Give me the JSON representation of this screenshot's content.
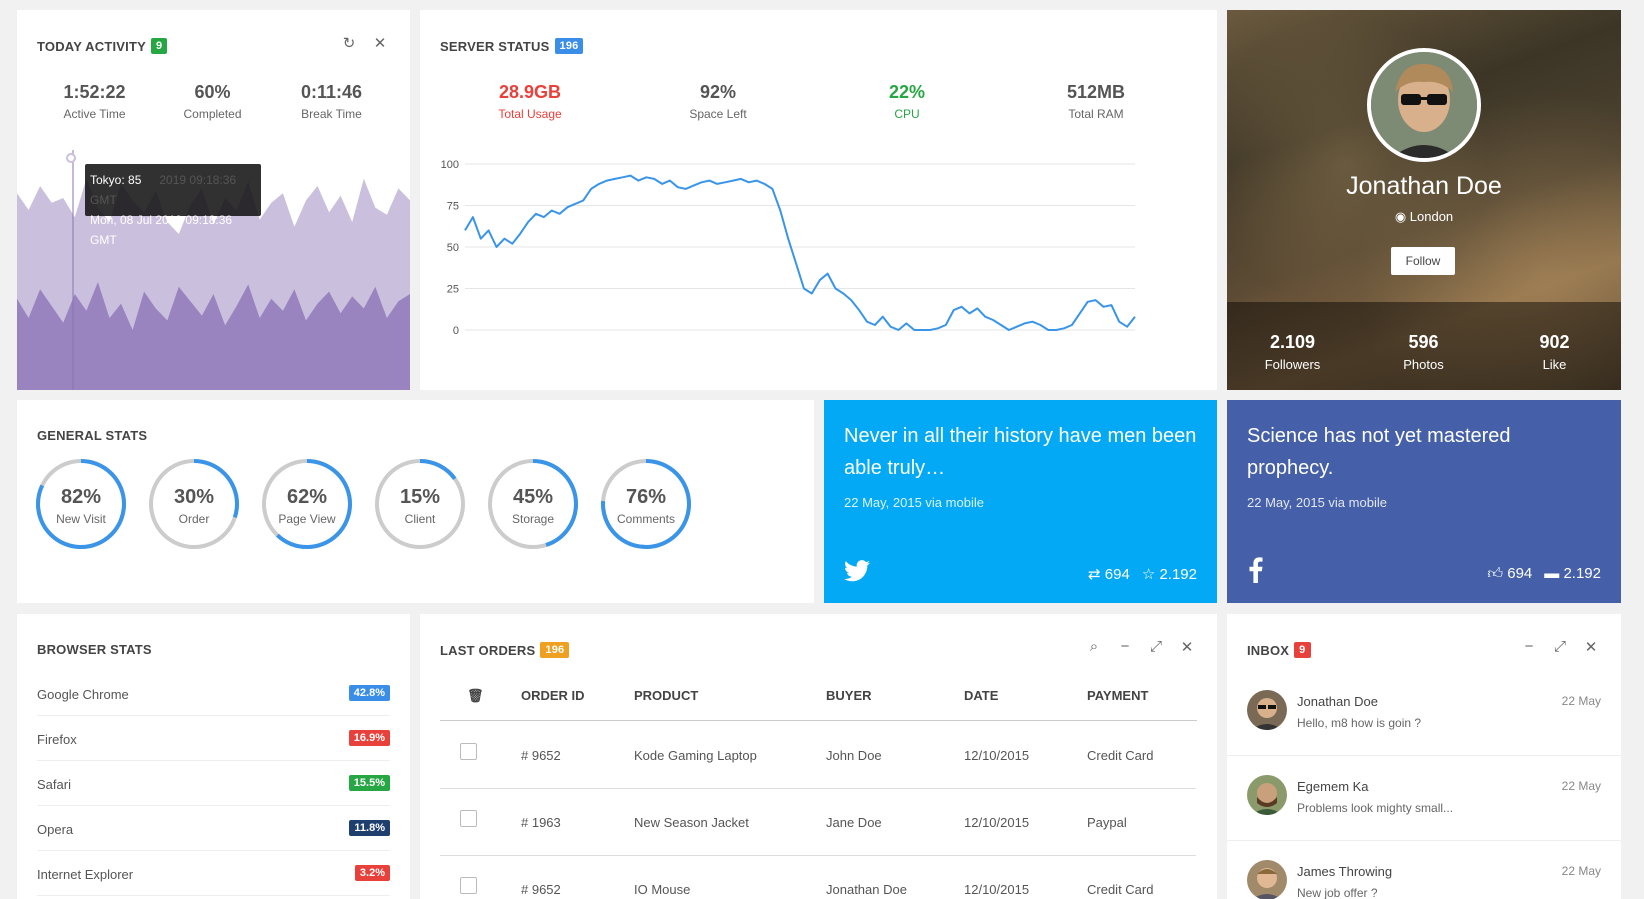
{
  "today": {
    "title": "TODAY ACTIVITY",
    "badge": "9",
    "stats": [
      {
        "value": "1:52:22",
        "label": "Active Time"
      },
      {
        "value": "60%",
        "label": "Completed"
      },
      {
        "value": "0:11:46",
        "label": "Break Time"
      }
    ],
    "tooltip": {
      "series": "Tokyo: 85",
      "time": "Mon, 08 Jul 2019 09:18:36 GMT",
      "ghost": "2019 09:18:36 GMT"
    },
    "back_series": [
      82,
      75,
      85,
      78,
      80,
      72,
      88,
      76,
      70,
      86,
      79,
      74,
      83,
      70,
      65,
      77,
      84,
      69,
      80,
      75,
      87,
      71,
      78,
      82,
      68,
      79,
      85,
      74,
      81,
      70,
      88,
      76,
      73,
      84,
      79
    ],
    "front_series": [
      38,
      30,
      42,
      35,
      28,
      40,
      33,
      45,
      30,
      36,
      25,
      41,
      34,
      29,
      43,
      37,
      31,
      40,
      27,
      35,
      44,
      30,
      38,
      33,
      42,
      29,
      36,
      41,
      32,
      39,
      34,
      43,
      30,
      37,
      40
    ],
    "colors": {
      "back": "#cbbfde",
      "front": "#9a84c0",
      "badge": "#27a744"
    }
  },
  "server": {
    "title": "SERVER STATUS",
    "badge": "196",
    "stats": [
      {
        "value": "28.9GB",
        "label": "Total Usage",
        "color": "#e8403a"
      },
      {
        "value": "92%",
        "label": "Space Left",
        "color": "#555555"
      },
      {
        "value": "22%",
        "label": "CPU",
        "color": "#27a744"
      },
      {
        "value": "512MB",
        "label": "Total RAM",
        "color": "#555555"
      }
    ],
    "colors": {
      "badge": "#3a8ee8",
      "line": "#3a95e8"
    }
  },
  "chart_data": {
    "type": "line",
    "title": "",
    "xlabel": "",
    "ylabel": "",
    "ylim": [
      0,
      100
    ],
    "yticks": [
      "100",
      "75",
      "50",
      "25",
      "0"
    ],
    "series": [
      {
        "values": [
          60,
          68,
          55,
          60,
          50,
          55,
          52,
          58,
          65,
          70,
          68,
          72,
          70,
          74,
          76,
          78,
          85,
          88,
          90,
          91,
          92,
          93,
          90,
          92,
          91,
          88,
          90,
          86,
          85,
          87,
          89,
          90,
          88,
          89,
          90,
          91,
          89,
          90,
          88,
          85,
          72,
          55,
          40,
          25,
          22,
          30,
          34,
          25,
          22,
          18,
          12,
          5,
          3,
          8,
          2,
          0,
          4,
          0,
          0,
          0,
          1,
          3,
          12,
          14,
          10,
          13,
          8,
          6,
          3,
          0,
          2,
          4,
          5,
          3,
          0,
          0,
          1,
          3,
          10,
          17,
          18,
          14,
          15,
          5,
          2,
          8
        ]
      }
    ]
  },
  "profile": {
    "name": "Jonathan Doe",
    "location": "London",
    "follow_label": "Follow",
    "stats": [
      {
        "value": "2.109",
        "label": "Followers"
      },
      {
        "value": "596",
        "label": "Photos"
      },
      {
        "value": "902",
        "label": "Like"
      }
    ]
  },
  "general": {
    "title": "GENERAL STATS",
    "gauges": [
      {
        "value": "82%",
        "label": "New Visit",
        "pct": 82
      },
      {
        "value": "30%",
        "label": "Order",
        "pct": 30
      },
      {
        "value": "62%",
        "label": "Page View",
        "pct": 62
      },
      {
        "value": "15%",
        "label": "Client",
        "pct": 15
      },
      {
        "value": "45%",
        "label": "Storage",
        "pct": 45
      },
      {
        "value": "76%",
        "label": "Comments",
        "pct": 76
      }
    ],
    "colors": {
      "track": "#cccccc",
      "fill": "#3a95e8"
    }
  },
  "twitter": {
    "quote": "Never in all their history have men been able truly…",
    "meta": "22 May, 2015 via mobile",
    "retweets": "694",
    "favorites": "2.192",
    "color": "#03a9f4"
  },
  "facebook": {
    "quote": "Science has not yet mastered prophecy.",
    "meta": "22 May, 2015 via mobile",
    "likes": "694",
    "comments": "2.192",
    "color": "#4560a8"
  },
  "browser": {
    "title": "BROWSER STATS",
    "items": [
      {
        "name": "Google Chrome",
        "pct": "42.8%",
        "color": "#3a8ee8"
      },
      {
        "name": "Firefox",
        "pct": "16.9%",
        "color": "#e8403a"
      },
      {
        "name": "Safari",
        "pct": "15.5%",
        "color": "#27a744"
      },
      {
        "name": "Opera",
        "pct": "11.8%",
        "color": "#1f3f6e"
      },
      {
        "name": "Internet Explorer",
        "pct": "3.2%",
        "color": "#e8403a"
      }
    ]
  },
  "orders": {
    "title": "LAST ORDERS",
    "badge": "196",
    "badge_color": "#f0a020",
    "headers": {
      "order_id": "ORDER ID",
      "product": "PRODUCT",
      "buyer": "BUYER",
      "date": "DATE",
      "payment": "PAYMENT"
    },
    "rows": [
      {
        "id": "# 9652",
        "product": "Kode Gaming Laptop",
        "buyer": "John Doe",
        "date": "12/10/2015",
        "payment": "Credit Card"
      },
      {
        "id": "# 1963",
        "product": "New Season Jacket",
        "buyer": "Jane Doe",
        "date": "12/10/2015",
        "payment": "Paypal"
      },
      {
        "id": "# 9652",
        "product": "IO Mouse",
        "buyer": "Jonathan Doe",
        "date": "12/10/2015",
        "payment": "Credit Card"
      }
    ]
  },
  "inbox": {
    "title": "INBOX",
    "badge": "9",
    "badge_color": "#e8403a",
    "messages": [
      {
        "name": "Jonathan Doe",
        "text": "Hello, m8 how is goin ?",
        "date": "22 May"
      },
      {
        "name": "Egemem Ka",
        "text": "Problems look mighty small...",
        "date": "22 May"
      },
      {
        "name": "James Throwing",
        "text": "New job offer ?",
        "date": "22 May"
      }
    ]
  }
}
